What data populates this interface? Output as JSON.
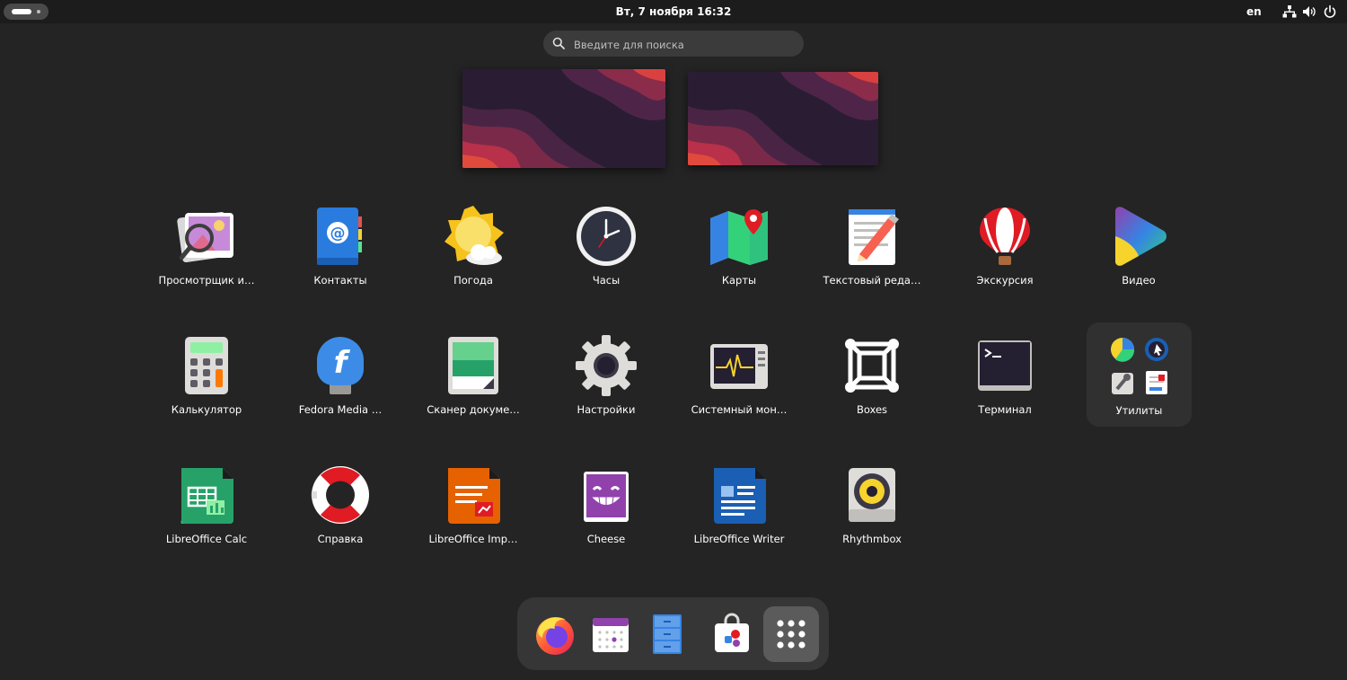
{
  "topbar": {
    "datetime": "Вт, 7 ноября  16:32",
    "language": "en"
  },
  "search": {
    "placeholder": "Введите для поиска"
  },
  "apps": [
    {
      "label": "Просмотрщик и…",
      "icon": "image-viewer-icon"
    },
    {
      "label": "Контакты",
      "icon": "contacts-icon"
    },
    {
      "label": "Погода",
      "icon": "weather-icon"
    },
    {
      "label": "Часы",
      "icon": "clock-icon"
    },
    {
      "label": "Карты",
      "icon": "maps-icon"
    },
    {
      "label": "Текстовый реда…",
      "icon": "text-editor-icon"
    },
    {
      "label": "Экскурсия",
      "icon": "tour-balloon-icon"
    },
    {
      "label": "Видео",
      "icon": "video-player-icon"
    },
    {
      "label": "Калькулятор",
      "icon": "calculator-icon"
    },
    {
      "label": "Fedora Media …",
      "icon": "fedora-media-writer-icon"
    },
    {
      "label": "Сканер докуме…",
      "icon": "document-scanner-icon"
    },
    {
      "label": "Настройки",
      "icon": "settings-gear-icon"
    },
    {
      "label": "Системный мон…",
      "icon": "system-monitor-icon"
    },
    {
      "label": "Boxes",
      "icon": "boxes-icon"
    },
    {
      "label": "Терминал",
      "icon": "terminal-icon"
    },
    {
      "label": "Утилиты",
      "icon": "utilities-folder-icon"
    },
    {
      "label": "LibreOffice Calc",
      "icon": "libreoffice-calc-icon"
    },
    {
      "label": "Справка",
      "icon": "help-lifebuoy-icon"
    },
    {
      "label": "LibreOffice Imp…",
      "icon": "libreoffice-impress-icon"
    },
    {
      "label": "Cheese",
      "icon": "cheese-icon"
    },
    {
      "label": "LibreOffice Writer",
      "icon": "libreoffice-writer-icon"
    },
    {
      "label": "Rhythmbox",
      "icon": "rhythmbox-icon"
    }
  ],
  "dock": [
    {
      "icon": "firefox-icon"
    },
    {
      "icon": "calendar-icon"
    },
    {
      "icon": "files-icon"
    },
    {
      "icon": "software-store-icon"
    },
    {
      "icon": "show-apps-grid-icon"
    }
  ]
}
